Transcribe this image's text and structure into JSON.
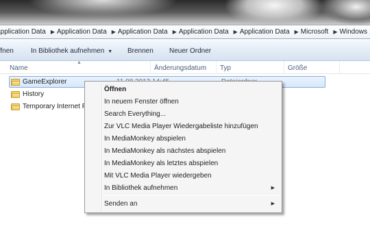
{
  "address_bar": {
    "crumbs": [
      "Application Data",
      "Application Data",
      "Application Data",
      "Application Data",
      "Application Data",
      "Microsoft",
      "Windows"
    ]
  },
  "command_bar": {
    "open": "Öffnen",
    "add_to_library": "In Bibliothek aufnehmen",
    "burn": "Brennen",
    "new_folder": "Neuer Ordner"
  },
  "columns": {
    "name": "Name",
    "date": "Änderungsdatum",
    "type": "Typ",
    "size": "Größe"
  },
  "files": [
    {
      "name": "GameExplorer",
      "date": "11.08.2013 14:45",
      "type": "Dateiordner"
    },
    {
      "name": "History"
    },
    {
      "name": "Temporary Internet Files"
    }
  ],
  "context_menu": {
    "open": "Öffnen",
    "open_new_window": "In neuem Fenster öffnen",
    "search_everything": "Search Everything...",
    "vlc_add_playlist": "Zur VLC Media Player Wiedergabeliste hinzufügen",
    "mm_play": "In MediaMonkey abspielen",
    "mm_play_next": "In MediaMonkey als nächstes abspielen",
    "mm_play_last": "In MediaMonkey als letztes abspielen",
    "vlc_play": "Mit VLC Media Player wiedergeben",
    "add_to_library": "In Bibliothek aufnehmen",
    "send_to": "Senden an"
  }
}
